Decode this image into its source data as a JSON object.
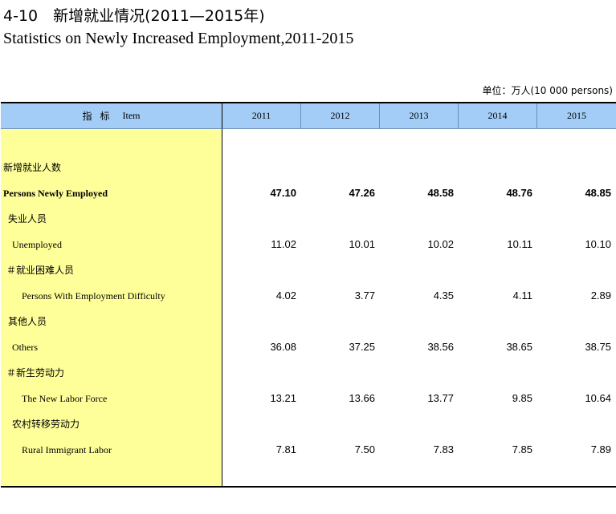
{
  "title_cn": "4-10　新增就业情况(2011—2015年)",
  "title_en": "Statistics on Newly Increased Employment,2011-2015",
  "unit": "单位：万人(10 000 persons)",
  "header": {
    "item_cn": "指标",
    "item_en": "Item",
    "years": [
      "2011",
      "2012",
      "2013",
      "2014",
      "2015"
    ]
  },
  "rows": [
    {
      "cn": "新增就业人数",
      "en": "Persons Newly Employed",
      "values": [
        "47.10",
        "47.26",
        "48.58",
        "48.76",
        "48.85"
      ]
    },
    {
      "cn": "失业人员",
      "en": "Unemployed",
      "values": [
        "11.02",
        "10.01",
        "10.02",
        "10.11",
        "10.10"
      ]
    },
    {
      "cn": "＃就业困难人员",
      "en": "Persons With Employment Difficulty",
      "values": [
        "4.02",
        "3.77",
        "4.35",
        "4.11",
        "2.89"
      ]
    },
    {
      "cn": "其他人员",
      "en": "Others",
      "values": [
        "36.08",
        "37.25",
        "38.56",
        "38.65",
        "38.75"
      ]
    },
    {
      "cn": "＃新生劳动力",
      "en": "The New Labor Force",
      "values": [
        "13.21",
        "13.66",
        "13.77",
        "9.85",
        "10.64"
      ]
    },
    {
      "cn": "农村转移劳动力",
      "en": "Rural Immigrant Labor",
      "values": [
        "7.81",
        "7.50",
        "7.83",
        "7.85",
        "7.89"
      ]
    }
  ]
}
